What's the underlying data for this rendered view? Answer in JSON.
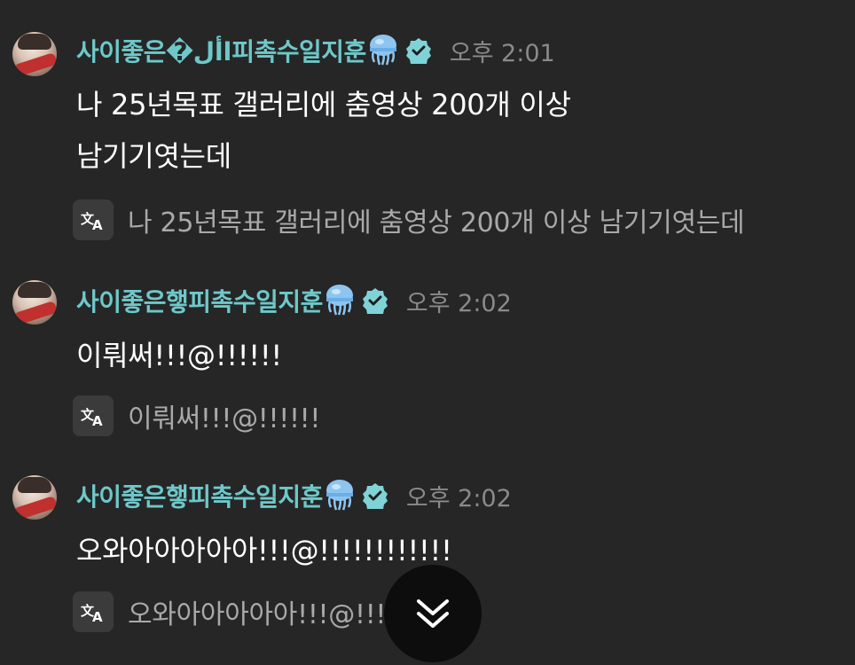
{
  "messages": [
    {
      "username": "사이좋은�األ피촉수일지훈",
      "time": "오후 2:01",
      "text_lines": [
        "나 25년목표 갤러리에 춤영상 200개 이상",
        "남기기엿는데"
      ],
      "translation": "나 25년목표 갤러리에 춤영상 200개 이상 남기기엿는데"
    },
    {
      "username": "사이좋은햏피촉수일지훈",
      "time": "오후 2:02",
      "text_lines": [
        "이뤄써!!!@!!!!!!"
      ],
      "translation": "이뤄써!!!@!!!!!!"
    },
    {
      "username": "사이좋은햏피촉수일지훈",
      "time": "오후 2:02",
      "text_lines": [
        "오와아아아아아!!!@!!!!!!!!!!!!"
      ],
      "translation": "오와아아아아아!!!@!!!!!!!!!!!!"
    }
  ],
  "icons": {
    "username_emoji": "jellyfish-icon",
    "verified": "verified-badge-icon",
    "translate": "translate-icon",
    "scroll": "double-chevron-down-icon"
  },
  "colors": {
    "background": "#262626",
    "username": "#6ec8c9",
    "timestamp": "#8a8a8a",
    "message_text": "#ffffff",
    "translation_text": "#a9a9a9",
    "verified_badge": "#7fd3d6"
  }
}
